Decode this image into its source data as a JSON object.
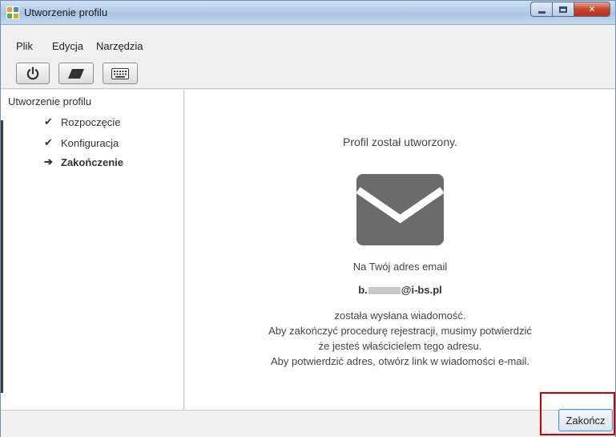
{
  "window": {
    "title": "Utworzenie profilu",
    "controls": [
      "minimize",
      "maximize",
      "close"
    ]
  },
  "menu": {
    "items": [
      "Plik",
      "Edycja",
      "Narzędzia"
    ]
  },
  "toolbar": {
    "buttons": [
      "power-icon",
      "eraser-icon",
      "keyboard-icon"
    ]
  },
  "sidebar": {
    "root": "Utworzenie profilu",
    "steps": [
      {
        "label": "Rozpoczęcie",
        "icon": "check-icon",
        "state": "done"
      },
      {
        "label": "Konfiguracja",
        "icon": "check-icon",
        "state": "done"
      },
      {
        "label": "Zakończenie",
        "icon": "arrow-right-icon",
        "state": "current"
      }
    ]
  },
  "main": {
    "status": "Profil został utworzony.",
    "envelope_icon": "envelope-icon",
    "lead": "Na Twój adres email",
    "email_prefix": "b.",
    "email_suffix": "@i-bs.pl",
    "lines": [
      "została wysłana wiadomość.",
      "Aby zakończyć procedurę rejestracji, musimy potwierdzić",
      "że jesteś właścicielem tego adresu.",
      "Aby potwierdzić adres, otwórz link w wiadomości e-mail."
    ]
  },
  "footer": {
    "finish_label": "Zakończ"
  },
  "colors": {
    "highlight": "#cc0000",
    "envelope": "#6b6b6b",
    "close_button": "#c8432a"
  }
}
